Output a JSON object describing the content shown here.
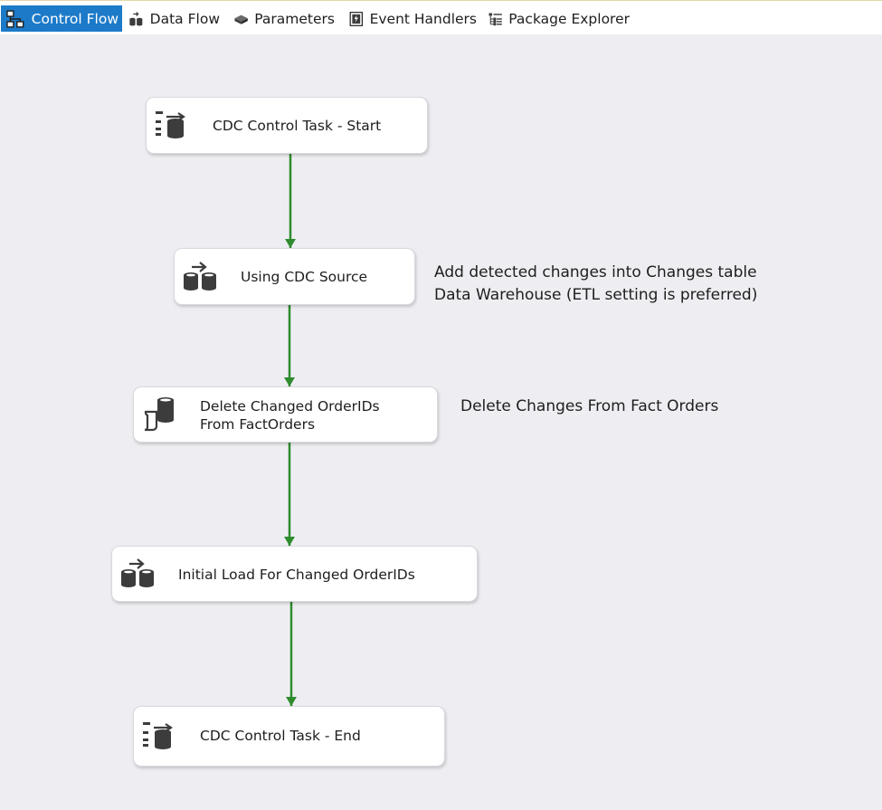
{
  "tabs": [
    {
      "label": "Control Flow",
      "icon": "control-flow-icon",
      "active": true
    },
    {
      "label": "Data Flow",
      "icon": "data-flow-icon",
      "active": false
    },
    {
      "label": "Parameters",
      "icon": "parameters-icon",
      "active": false
    },
    {
      "label": "Event Handlers",
      "icon": "event-handlers-icon",
      "active": false
    },
    {
      "label": "Package Explorer",
      "icon": "package-explorer-icon",
      "active": false
    }
  ],
  "tasks": [
    {
      "label": "CDC Control Task - Start",
      "icon": "cdc-control-task-icon"
    },
    {
      "label": "Using CDC Source",
      "icon": "data-flow-task-icon"
    },
    {
      "label_line1": "Delete Changed OrderIDs",
      "label_line2": "From FactOrders",
      "icon": "execute-sql-task-icon"
    },
    {
      "label": "Initial Load For Changed OrderIDs",
      "icon": "data-flow-task-icon"
    },
    {
      "label": "CDC Control Task - End",
      "icon": "cdc-control-task-icon"
    }
  ],
  "annotations": [
    {
      "line1": "Add detected changes into Changes table",
      "line2": "Data Warehouse (ETL setting is preferred)"
    },
    {
      "line1": "Delete Changes From Fact Orders"
    }
  ],
  "colors": {
    "active_tab": "#1c7ac9",
    "canvas": "#eeeef2",
    "precedence_constraint": "#2e8b2e",
    "icon_dark": "#3c3c3c"
  }
}
